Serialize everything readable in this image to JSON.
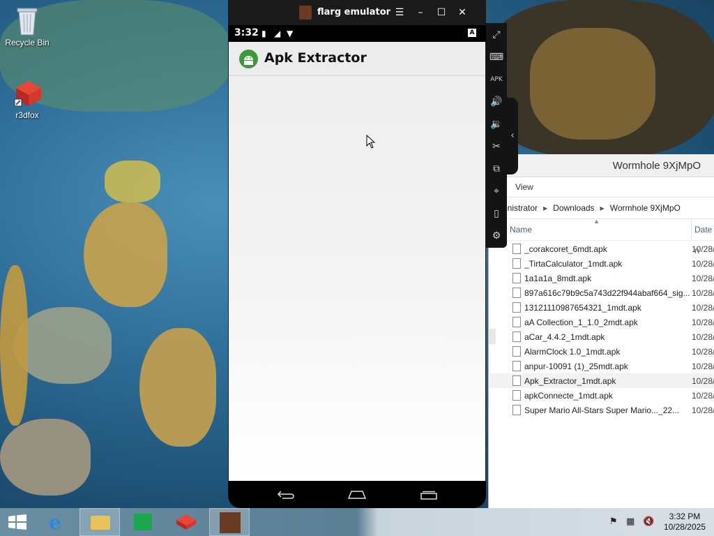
{
  "desktop": {
    "icons": [
      {
        "label": "Recycle Bin",
        "icon": "recycle-bin-icon"
      },
      {
        "label": "r3dfox",
        "icon": "r3dfox-icon"
      }
    ]
  },
  "emulator": {
    "window_title": "flarg emulator",
    "statusbar": {
      "time": "3:32",
      "badge": "A"
    },
    "app": {
      "title": "Apk Extractor"
    }
  },
  "explorer": {
    "window_title": "Wormhole 9XjMpO",
    "ribbon": {
      "view_tab": "View"
    },
    "breadcrumb": [
      "inistrator",
      "Downloads",
      "Wormhole 9XjMpO"
    ],
    "columns": {
      "name": "Name",
      "date": "Date n"
    },
    "files": [
      {
        "name": "_corakcoret_6mdt.apk",
        "date": "10/28/"
      },
      {
        "name": "_TirtaCalculator_1mdt.apk",
        "date": "10/28/"
      },
      {
        "name": "1a1a1a_8mdt.apk",
        "date": "10/28/"
      },
      {
        "name": "897a616c79b9c5a743d22f944abaf664_sig...",
        "date": "10/28/"
      },
      {
        "name": "13121110987654321_1mdt.apk",
        "date": "10/28/"
      },
      {
        "name": "aA Collection_1_1.0_2mdt.apk",
        "date": "10/28/"
      },
      {
        "name": "aCar_4.4.2_1mdt.apk",
        "date": "10/28/"
      },
      {
        "name": "AlarmClock 1.0_1mdt.apk",
        "date": "10/28/"
      },
      {
        "name": "anpur-10091 (1)_25mdt.apk",
        "date": "10/28/"
      },
      {
        "name": "Apk_Extractor_1mdt.apk",
        "date": "10/28/"
      },
      {
        "name": "apkConnecte_1mdt.apk",
        "date": "10/28/"
      },
      {
        "name": "Super Mario All-Stars  Super Mario..._22...",
        "date": "10/28/"
      }
    ]
  },
  "taskbar": {
    "clock_time": "3:32 PM",
    "clock_date": "10/28/2025"
  },
  "colors": {
    "emulator_frame": "#1a1a1a",
    "app_bar": "#ececec",
    "android_green": "#3c9a3c"
  }
}
